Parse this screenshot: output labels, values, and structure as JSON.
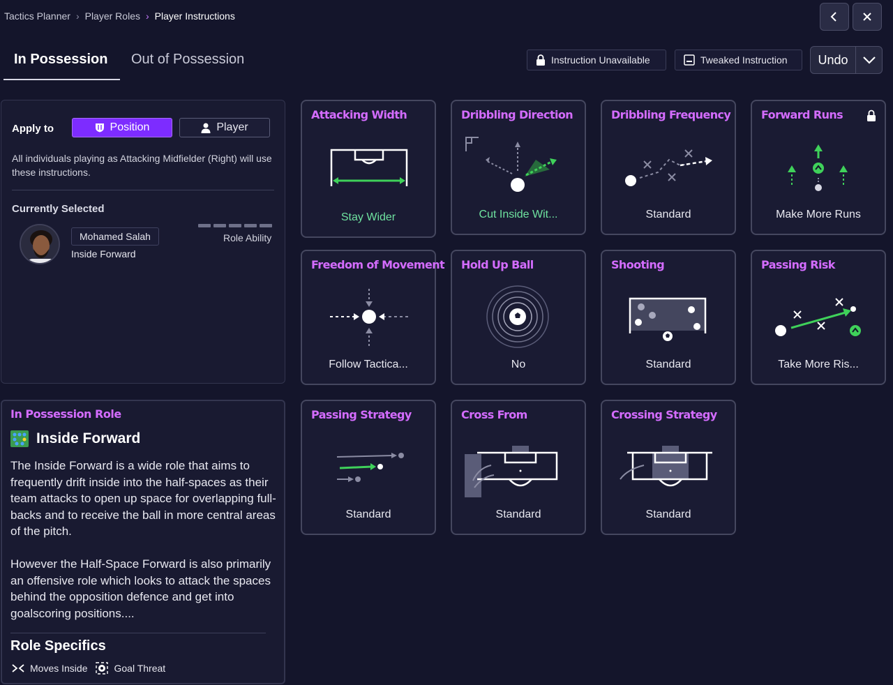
{
  "breadcrumb": [
    "Tactics Planner",
    "Player Roles",
    "Player Instructions"
  ],
  "tabs": {
    "active": "In Possession",
    "inactive": "Out of Possession"
  },
  "legend": {
    "unavailable": "Instruction Unavailable",
    "tweaked": "Tweaked Instruction"
  },
  "undo": "Undo",
  "apply": {
    "label": "Apply to",
    "position": "Position",
    "player": "Player",
    "description": "All individuals playing as Attacking Midfielder (Right) will use these instructions."
  },
  "current": {
    "label": "Currently Selected",
    "player_name": "Mohamed Salah",
    "player_role": "Inside Forward",
    "role_ability_label": "Role Ability"
  },
  "role_panel": {
    "title": "In Possession Role",
    "role": "Inside Forward",
    "desc1": "The Inside Forward is a wide role that aims to frequently drift inside into the half-spaces as their team attacks to open up space for overlapping full-backs and to receive the ball in more central areas of the pitch.",
    "desc2": "However the Half-Space Forward is also primarily an offensive role which looks to attack the spaces behind the opposition defence and get into goalscoring positions....",
    "specifics_title": "Role Specifics",
    "specifics": [
      "Moves Inside",
      "Goal Threat"
    ]
  },
  "cards": [
    {
      "title": "Attacking Width",
      "value": "Stay Wider"
    },
    {
      "title": "Dribbling Direction",
      "value": "Cut Inside Wit..."
    },
    {
      "title": "Dribbling Frequency",
      "value": "Standard"
    },
    {
      "title": "Forward Runs",
      "value": "Make More Runs"
    },
    {
      "title": "Freedom of Movement",
      "value": "Follow Tactica..."
    },
    {
      "title": "Hold Up Ball",
      "value": "No"
    },
    {
      "title": "Shooting",
      "value": "Standard"
    },
    {
      "title": "Passing Risk",
      "value": "Take More Ris..."
    },
    {
      "title": "Passing Strategy",
      "value": "Standard"
    },
    {
      "title": "Cross From",
      "value": "Standard"
    },
    {
      "title": "Crossing Strategy",
      "value": "Standard"
    }
  ],
  "colors": {
    "accent": "#d46cff",
    "primary": "#7d2cff",
    "green": "#3fd15a",
    "background": "#14152b"
  }
}
